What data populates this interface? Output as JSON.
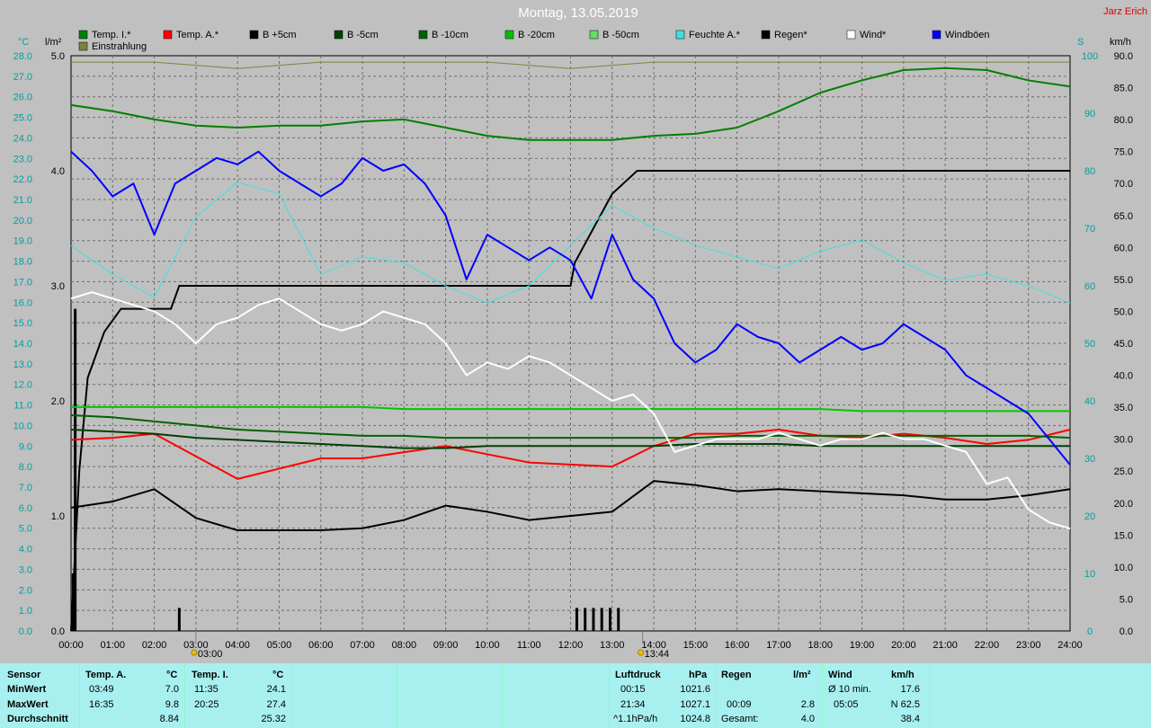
{
  "title": "Montag, 13.05.2019",
  "author": "Jarz Erich",
  "units": {
    "left_temp": "°C",
    "left_rain": "l/m²",
    "right_wind": "km/h",
    "right_s": "S"
  },
  "legend": [
    {
      "label": "Temp. I.*",
      "color": "#008000"
    },
    {
      "label": "Temp. A.*",
      "color": "#ff0000"
    },
    {
      "label": "B +5cm",
      "color": "#000000"
    },
    {
      "label": "B -5cm",
      "color": "#004000"
    },
    {
      "label": "B -10cm",
      "color": "#006400"
    },
    {
      "label": "B -20cm",
      "color": "#00c000"
    },
    {
      "label": "B -50cm",
      "color": "#60e060"
    },
    {
      "label": "Feuchte A.*",
      "color": "#40e0e0"
    },
    {
      "label": "Regen*",
      "color": "#000000"
    },
    {
      "label": "Wind*",
      "color": "#ffffff"
    },
    {
      "label": "Windböen",
      "color": "#0000ff"
    },
    {
      "label": "Einstrahlung",
      "color": "#808040"
    }
  ],
  "markers": {
    "sunrise": "03:00",
    "sunset": "13:44"
  },
  "chart_data": {
    "type": "line",
    "x_labels": [
      "00:00",
      "01:00",
      "02:00",
      "03:00",
      "04:00",
      "05:00",
      "06:00",
      "07:00",
      "08:00",
      "09:00",
      "10:00",
      "11:00",
      "12:00",
      "13:00",
      "14:00",
      "15:00",
      "16:00",
      "17:00",
      "18:00",
      "19:00",
      "20:00",
      "21:00",
      "22:00",
      "23:00",
      "24:00"
    ],
    "xlim": [
      0,
      24
    ],
    "y_temp_ticks": [
      "0.0",
      "1.0",
      "2.0",
      "3.0",
      "4.0",
      "5.0",
      "6.0",
      "7.0",
      "8.0",
      "9.0",
      "10.0",
      "11.0",
      "12.0",
      "13.0",
      "14.0",
      "15.0",
      "16.0",
      "17.0",
      "18.0",
      "19.0",
      "20.0",
      "21.0",
      "22.0",
      "23.0",
      "24.0",
      "25.0",
      "26.0",
      "27.0",
      "28.0"
    ],
    "ylim_temp": [
      0,
      28
    ],
    "y_rain_ticks": [
      "0.0",
      "1.0",
      "2.0",
      "3.0",
      "4.0",
      "5.0"
    ],
    "ylim_rain": [
      0,
      5
    ],
    "y_humidity_ticks": [
      "0",
      "10",
      "20",
      "30",
      "40",
      "50",
      "60",
      "70",
      "80",
      "90",
      "100"
    ],
    "ylim_humidity": [
      0,
      100
    ],
    "y_wind_ticks": [
      "0.0",
      "5.0",
      "10.0",
      "15.0",
      "20.0",
      "25.0",
      "30.0",
      "35.0",
      "40.0",
      "45.0",
      "50.0",
      "55.0",
      "60.0",
      "65.0",
      "70.0",
      "75.0",
      "80.0",
      "85.0",
      "90.0"
    ],
    "ylim_wind": [
      0,
      90
    ],
    "grid": true,
    "series": [
      {
        "name": "Temp. I.*",
        "axis": "temp",
        "color": "#008000",
        "width": 2,
        "x": [
          0,
          1,
          2,
          3,
          4,
          5,
          6,
          7,
          8,
          9,
          10,
          11,
          12,
          13,
          14,
          15,
          16,
          17,
          18,
          19,
          20,
          21,
          22,
          23,
          24
        ],
        "y": [
          25.6,
          25.3,
          24.9,
          24.6,
          24.5,
          24.6,
          24.6,
          24.8,
          24.9,
          24.5,
          24.1,
          23.9,
          23.9,
          23.9,
          24.1,
          24.2,
          24.5,
          25.3,
          26.2,
          26.8,
          27.3,
          27.4,
          27.3,
          26.8,
          26.5
        ]
      },
      {
        "name": "Temp. A.*",
        "axis": "temp",
        "color": "#ff0000",
        "width": 2,
        "x": [
          0,
          1,
          2,
          3,
          4,
          5,
          6,
          7,
          8,
          9,
          10,
          11,
          12,
          13,
          14,
          15,
          16,
          17,
          18,
          19,
          20,
          21,
          22,
          23,
          24
        ],
        "y": [
          9.3,
          9.4,
          9.6,
          8.5,
          7.4,
          7.9,
          8.4,
          8.4,
          8.7,
          9.0,
          8.6,
          8.2,
          8.1,
          8.0,
          9.0,
          9.6,
          9.6,
          9.8,
          9.5,
          9.4,
          9.6,
          9.4,
          9.1,
          9.3,
          9.8
        ]
      },
      {
        "name": "B +5cm",
        "axis": "temp",
        "color": "#000000",
        "width": 2,
        "x": [
          0,
          1,
          2,
          3,
          4,
          5,
          6,
          7,
          8,
          9,
          10,
          11,
          12,
          13,
          14,
          15,
          16,
          17,
          18,
          19,
          20,
          21,
          22,
          23,
          24
        ],
        "y": [
          6.0,
          6.3,
          6.9,
          5.5,
          4.9,
          4.9,
          4.9,
          5.0,
          5.4,
          6.1,
          5.8,
          5.4,
          5.6,
          5.8,
          7.3,
          7.1,
          6.8,
          6.9,
          6.8,
          6.7,
          6.6,
          6.4,
          6.4,
          6.6,
          6.9
        ]
      },
      {
        "name": "B -5cm",
        "axis": "temp",
        "color": "#004000",
        "width": 2,
        "x": [
          0,
          1,
          2,
          3,
          4,
          5,
          6,
          7,
          8,
          9,
          10,
          11,
          12,
          13,
          14,
          15,
          16,
          17,
          18,
          19,
          20,
          21,
          22,
          23,
          24
        ],
        "y": [
          9.8,
          9.7,
          9.6,
          9.4,
          9.3,
          9.2,
          9.1,
          9.0,
          8.9,
          8.9,
          9.0,
          9.0,
          9.0,
          9.0,
          9.0,
          9.1,
          9.1,
          9.1,
          9.0,
          9.0,
          9.0,
          9.0,
          9.0,
          9.0,
          9.0
        ]
      },
      {
        "name": "B -10cm",
        "axis": "temp",
        "color": "#006400",
        "width": 2,
        "x": [
          0,
          1,
          2,
          3,
          4,
          5,
          6,
          7,
          8,
          9,
          10,
          11,
          12,
          13,
          14,
          15,
          16,
          17,
          18,
          19,
          20,
          21,
          22,
          23,
          24
        ],
        "y": [
          10.5,
          10.4,
          10.2,
          10.0,
          9.8,
          9.7,
          9.6,
          9.5,
          9.5,
          9.4,
          9.4,
          9.4,
          9.4,
          9.4,
          9.4,
          9.4,
          9.5,
          9.5,
          9.5,
          9.5,
          9.5,
          9.5,
          9.5,
          9.5,
          9.4
        ]
      },
      {
        "name": "B -20cm",
        "axis": "temp",
        "color": "#00c800",
        "width": 2,
        "x": [
          0,
          1,
          2,
          3,
          4,
          5,
          6,
          7,
          8,
          9,
          10,
          11,
          12,
          13,
          14,
          15,
          16,
          17,
          18,
          19,
          20,
          21,
          22,
          23,
          24
        ],
        "y": [
          10.9,
          10.9,
          10.9,
          10.9,
          10.9,
          10.9,
          10.9,
          10.9,
          10.8,
          10.8,
          10.8,
          10.8,
          10.8,
          10.8,
          10.8,
          10.8,
          10.8,
          10.8,
          10.8,
          10.7,
          10.7,
          10.7,
          10.7,
          10.7,
          10.7
        ]
      },
      {
        "name": "Feuchte A.*",
        "axis": "humidity",
        "color": "#40e0e0",
        "width": 1,
        "x": [
          0,
          1,
          2,
          3,
          4,
          5,
          6,
          7,
          8,
          9,
          10,
          11,
          12,
          13,
          14,
          15,
          16,
          17,
          18,
          19,
          20,
          21,
          22,
          23,
          24
        ],
        "y": [
          67,
          62,
          58,
          72,
          78,
          76,
          62,
          65,
          64,
          60,
          57,
          60,
          67,
          74,
          70,
          67,
          65,
          63,
          66,
          68,
          64,
          61,
          62,
          60,
          57
        ]
      },
      {
        "name": "Wind*",
        "axis": "wind",
        "color": "#ffffff",
        "width": 2,
        "x": [
          0,
          0.5,
          1,
          1.5,
          2,
          2.5,
          3,
          3.5,
          4,
          4.5,
          5,
          5.5,
          6,
          6.5,
          7,
          7.5,
          8,
          8.5,
          9,
          9.5,
          10,
          10.5,
          11,
          11.5,
          12,
          12.5,
          13,
          13.5,
          14,
          14.5,
          15,
          15.5,
          16,
          16.5,
          17,
          17.5,
          18,
          18.5,
          19,
          19.5,
          20,
          20.5,
          21,
          21.5,
          22,
          22.5,
          23,
          23.5,
          24
        ],
        "y": [
          52,
          53,
          52,
          51,
          50,
          48,
          45,
          48,
          49,
          51,
          52,
          50,
          48,
          47,
          48,
          50,
          49,
          48,
          45,
          40,
          42,
          41,
          43,
          42,
          40,
          38,
          36,
          37,
          34,
          28,
          29,
          30,
          30,
          30,
          31,
          30,
          29,
          30,
          30,
          31,
          30,
          30,
          29,
          28,
          23,
          24,
          19,
          17,
          16
        ]
      },
      {
        "name": "Windböen",
        "axis": "wind",
        "color": "#0000ff",
        "width": 2,
        "x": [
          0,
          0.5,
          1,
          1.5,
          2,
          2.5,
          3,
          3.5,
          4,
          4.5,
          5,
          5.5,
          6,
          6.5,
          7,
          7.5,
          8,
          8.5,
          9,
          9.5,
          10,
          10.5,
          11,
          11.5,
          12,
          12.5,
          13,
          13.5,
          14,
          14.5,
          15,
          15.5,
          16,
          16.5,
          17,
          17.5,
          18,
          18.5,
          19,
          19.5,
          20,
          20.5,
          21,
          21.5,
          22,
          22.5,
          23,
          23.5,
          24
        ],
        "y": [
          75,
          72,
          68,
          70,
          62,
          70,
          72,
          74,
          73,
          75,
          72,
          70,
          68,
          70,
          74,
          72,
          73,
          70,
          65,
          55,
          62,
          60,
          58,
          60,
          58,
          52,
          62,
          55,
          52,
          45,
          42,
          44,
          48,
          46,
          45,
          42,
          44,
          46,
          44,
          45,
          48,
          46,
          44,
          40,
          38,
          36,
          34,
          30,
          26
        ]
      },
      {
        "name": "Einstrahlung",
        "axis": "wind",
        "color": "#808040",
        "width": 1,
        "x": [
          0,
          2,
          4,
          6,
          8,
          10,
          12,
          14,
          16,
          18,
          20,
          22,
          24
        ],
        "y": [
          89,
          89,
          88,
          89,
          89,
          89,
          88,
          89,
          89,
          89,
          89,
          89,
          89
        ]
      }
    ],
    "rain_bars": [
      {
        "x": 0.1,
        "value": 2.8
      },
      {
        "x": 0.05,
        "value": 0.5
      },
      {
        "x": 2.6,
        "value": 0.2
      },
      {
        "x": 12.15,
        "value": 0.2
      },
      {
        "x": 12.35,
        "value": 0.2
      },
      {
        "x": 12.55,
        "value": 0.2
      },
      {
        "x": 12.75,
        "value": 0.2
      },
      {
        "x": 12.95,
        "value": 0.2
      },
      {
        "x": 13.15,
        "value": 0.2
      }
    ],
    "rain_cumulative": {
      "x": [
        0,
        0.2,
        0.4,
        0.8,
        1.2,
        1.6,
        2.0,
        2.4,
        2.6,
        3.0,
        3.5,
        4,
        6,
        8,
        10,
        12,
        12.1,
        12.4,
        12.7,
        13.0,
        13.3,
        13.6,
        14,
        24
      ],
      "y": [
        0,
        1.4,
        2.2,
        2.6,
        2.8,
        2.8,
        2.8,
        2.8,
        3.0,
        3.0,
        3.0,
        3.0,
        3.0,
        3.0,
        3.0,
        3.0,
        3.2,
        3.4,
        3.6,
        3.8,
        3.9,
        4.0,
        4.0,
        4.0
      ]
    }
  },
  "summary": {
    "sensor": {
      "header": "Sensor",
      "rows": [
        "MinWert",
        "MaxWert",
        "Durchschnitt"
      ]
    },
    "temp_a": {
      "header": "Temp. A.",
      "unit": "°C",
      "rows": [
        {
          "time": "03:49",
          "value": "7.0"
        },
        {
          "time": "16:35",
          "value": "9.8"
        },
        {
          "time": "",
          "value": "8.84"
        }
      ]
    },
    "temp_i": {
      "header": "Temp. I.",
      "unit": "°C",
      "rows": [
        {
          "time": "11:35",
          "value": "24.1"
        },
        {
          "time": "20:25",
          "value": "27.4"
        },
        {
          "time": "",
          "value": "25.32"
        }
      ]
    },
    "pressure": {
      "header": "Luftdruck",
      "unit": "hPa",
      "rows": [
        {
          "time": "00:15",
          "value": "1021.6"
        },
        {
          "time": "21:34",
          "value": "1027.1"
        },
        {
          "time": "^1.1hPa/h",
          "value": "1024.8"
        }
      ]
    },
    "rain": {
      "header": "Regen",
      "unit": "l/m²",
      "rows": [
        {
          "time": "",
          "value": ""
        },
        {
          "time": "00:09",
          "value": "2.8"
        },
        {
          "time": "Gesamt:",
          "value": "4.0"
        }
      ]
    },
    "wind": {
      "header": "Wind",
      "unit": "km/h",
      "rows": [
        {
          "time": "Ø 10 min.",
          "value": "17.6"
        },
        {
          "time": "05:05",
          "value": "N 62.5"
        },
        {
          "time": "",
          "value": "38.4"
        }
      ]
    }
  }
}
